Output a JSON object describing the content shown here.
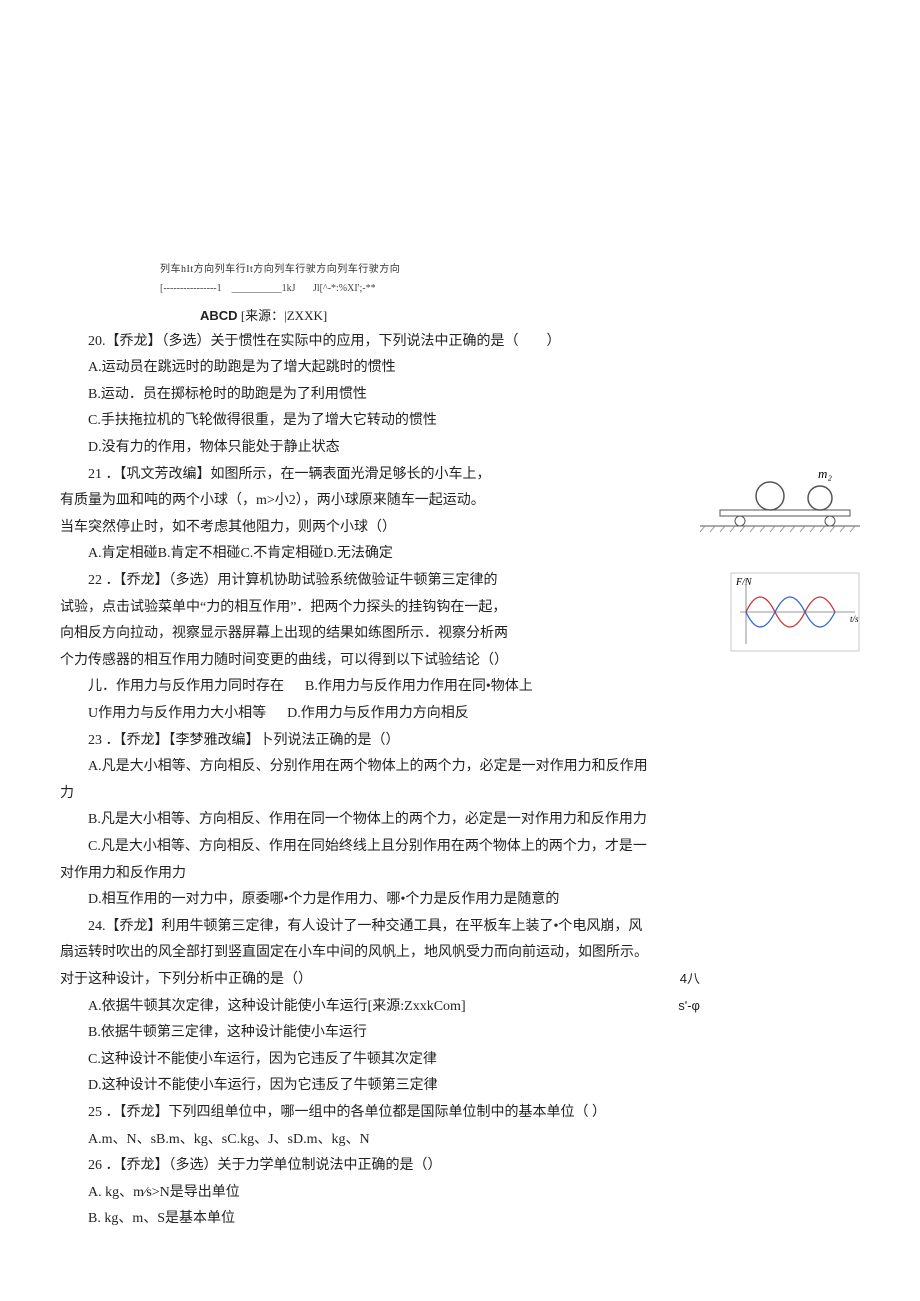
{
  "top": {
    "small_header": "列车hIt方向列车行It方向列车行驶方向列车行驶方向",
    "dotted": "[----------------1    __________1kJ       Jl[^-*:%XI';-**",
    "abcd": "ABCD",
    "source": "[来源：|ZXXK]"
  },
  "q20": {
    "stem": "20.【乔龙】（多选）关于惯性在实际中的应用，下列说法中正确的是（　　）",
    "A": "A.运动员在跳远时的助跑是为了增大起跳时的惯性",
    "B": "B.运动．员在掷标枪时的助跑是为了利用惯性",
    "C": "C.手扶拖拉机的飞轮做得很重，是为了增大它转动的惯性",
    "D": "D.没有力的作用，物体只能处于静止状态"
  },
  "q21": {
    "stem1": "21 ．【巩文芳改编】如图所示，在一辆表面光滑足够长的小车上，",
    "stem2": "有质量为皿和吨的两个小球（，m>小2），两小球原来随车一起运动。",
    "stem3": "当车突然停止时，如不考虑其他阻力，则两个小球（）",
    "opts": "A.肯定相碰B.肯定不相碰C.不肯定相碰D.无法确定",
    "fig_label": "m₂"
  },
  "q22": {
    "stem1": "22 ．【乔龙】（多选）用计算机协助试验系统做验证牛顿第三定律的",
    "stem2": "试验，点击试验菜单中“力的相互作用”．把两个力探头的挂钩钩在一起，",
    "stem3": "向相反方向拉动，视察显示器屏幕上出现的结果如练图所示．视察分析两",
    "stem4": "个力传感器的相互作用力随时间变更的曲线，可以得到以下试验结论（）",
    "row1a": "儿．作用力与反作用力同时存在",
    "row1b": "B.作用力与反作用力作用在同•物体上",
    "row2a": "U作用力与反作用力大小相等",
    "row2b": "D.作用力与反作用力方向相反",
    "fig_ylabel": "F/N"
  },
  "q23": {
    "stem": "23 ．【乔龙】【李梦雅改编】卜列说法正确的是（）",
    "A": "A.凡是大小相等、方向相反、分别作用在两个物体上的两个力，必定是一对作用力和反作用",
    "A2": "力",
    "B": "B.凡是大小相等、方向相反、作用在同一个物体上的两个力，必定是一对作用力和反作用力",
    "C": "C.凡是大小相等、方向相反、作用在同始终线上且分别作用在两个物体上的两个力，才是一",
    "C2": "对作用力和反作用力",
    "D": "D.相互作用的一对力中，原委哪•个力是作用力、哪•个力是反作用力是随意的"
  },
  "q24": {
    "stem1": "24.【乔龙】利用牛顿第三定律，有人设计了一种交通工具，在平板车上装了•个电风崩，风",
    "stem2": "扇运转时吹出的风全部打到竖直固定在小车中间的风帆上，地风帆受力而向前运动，如图所示。",
    "stem3": "对于这种设计，下列分析中正确的是（）",
    "side1": "4八",
    "side2": "s'-φ",
    "A": "A.依据牛顿其次定律，这种设计能使小车运行[来源:ZxxkCom]",
    "B": "B.依据牛顿第三定律，这种设计能使小车运行",
    "C": "C.这种设计不能使小车运行，因为它违反了牛顿其次定律",
    "D": "D.这种设计不能使小车运行，因为它违反了牛顿第三定律"
  },
  "q25": {
    "stem": "25 ．【乔龙】下列四组单位中，哪一组中的各单位都是国际单位制中的基本单位（    ）",
    "opts": "A.m、N、sB.m、kg、sC.kg、J、sD.m、kg、N"
  },
  "q26": {
    "stem": "26 ．【乔龙】（多选）关于力学单位制说法中正确的是（）",
    "A": "A.    kg、m⁄s>N是导出单位",
    "B": "B.    kg、m、S是基本单位"
  }
}
